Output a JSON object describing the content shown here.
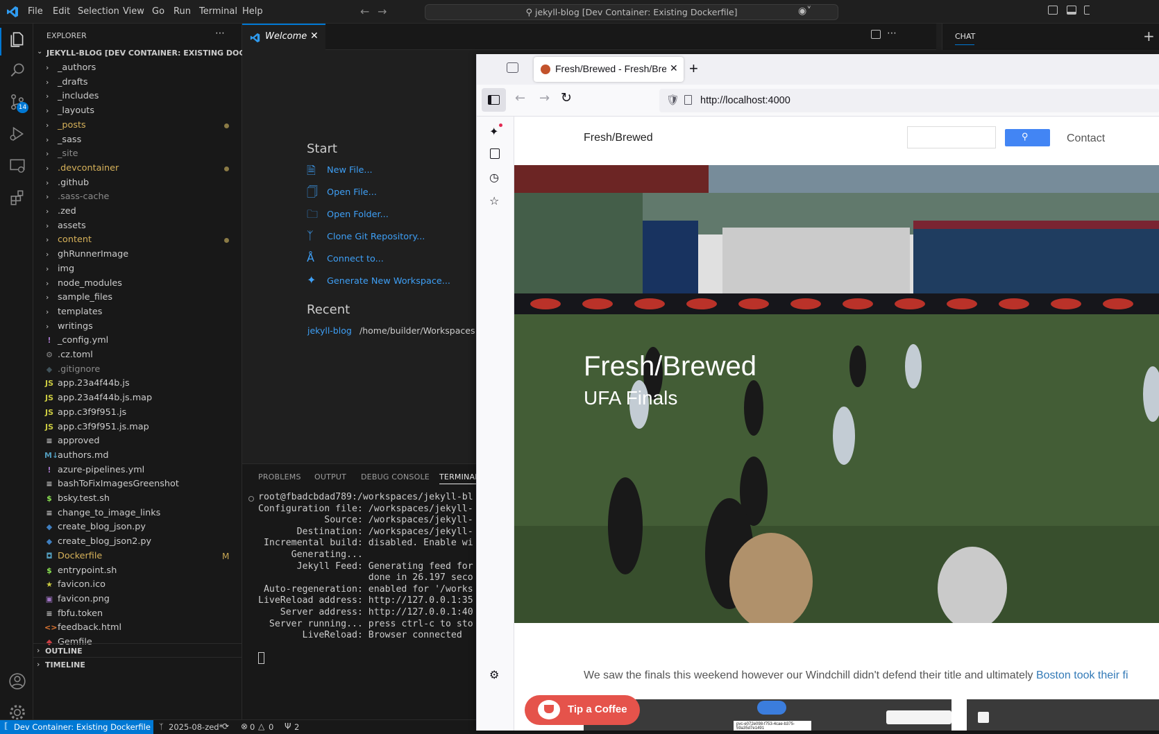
{
  "menu": [
    "File",
    "Edit",
    "Selection",
    "View",
    "Go",
    "Run",
    "Terminal",
    "Help"
  ],
  "command_center": "jekyll-blog [Dev Container: Existing Dockerfile]",
  "activity": {
    "scm_badge": "14"
  },
  "explorer": {
    "title": "EXPLORER",
    "root": "JEKYLL-BLOG [DEV CONTAINER: EXISTING DOCKER...",
    "items": [
      {
        "label": "_authors",
        "type": "folder"
      },
      {
        "label": "_drafts",
        "type": "folder"
      },
      {
        "label": "_includes",
        "type": "folder"
      },
      {
        "label": "_layouts",
        "type": "folder"
      },
      {
        "label": "_posts",
        "type": "folder",
        "modified": true
      },
      {
        "label": "_sass",
        "type": "folder"
      },
      {
        "label": "_site",
        "type": "folder",
        "dim": true
      },
      {
        "label": ".devcontainer",
        "type": "folder",
        "modified": true
      },
      {
        "label": ".github",
        "type": "folder"
      },
      {
        "label": ".sass-cache",
        "type": "folder",
        "dim": true
      },
      {
        "label": ".zed",
        "type": "folder"
      },
      {
        "label": "assets",
        "type": "folder"
      },
      {
        "label": "content",
        "type": "folder",
        "modified": true
      },
      {
        "label": "ghRunnerImage",
        "type": "folder"
      },
      {
        "label": "img",
        "type": "folder"
      },
      {
        "label": "node_modules",
        "type": "folder"
      },
      {
        "label": "sample_files",
        "type": "folder"
      },
      {
        "label": "templates",
        "type": "folder"
      },
      {
        "label": "writings",
        "type": "folder"
      },
      {
        "label": "_config.yml",
        "type": "yml"
      },
      {
        "label": ".cz.toml",
        "type": "gear"
      },
      {
        "label": ".gitignore",
        "type": "git",
        "dim": true
      },
      {
        "label": "app.23a4f44b.js",
        "type": "js"
      },
      {
        "label": "app.23a4f44b.js.map",
        "type": "js"
      },
      {
        "label": "app.c3f9f951.js",
        "type": "js"
      },
      {
        "label": "app.c3f9f951.js.map",
        "type": "js"
      },
      {
        "label": "approved",
        "type": "text"
      },
      {
        "label": "authors.md",
        "type": "md"
      },
      {
        "label": "azure-pipelines.yml",
        "type": "yml"
      },
      {
        "label": "bashToFixImagesGreenshot",
        "type": "text"
      },
      {
        "label": "bsky.test.sh",
        "type": "sh"
      },
      {
        "label": "change_to_image_links",
        "type": "text"
      },
      {
        "label": "create_blog_json.py",
        "type": "py"
      },
      {
        "label": "create_blog_json2.py",
        "type": "py"
      },
      {
        "label": "Dockerfile",
        "type": "docker",
        "flag": "M"
      },
      {
        "label": "entrypoint.sh",
        "type": "sh"
      },
      {
        "label": "favicon.ico",
        "type": "star"
      },
      {
        "label": "favicon.png",
        "type": "img"
      },
      {
        "label": "fbfu.token",
        "type": "text"
      },
      {
        "label": "feedback.html",
        "type": "html"
      },
      {
        "label": "Gemfile",
        "type": "gem"
      }
    ],
    "outline": "OUTLINE",
    "timeline": "TIMELINE"
  },
  "editor": {
    "tab_label": "Welcome",
    "start_title": "Start",
    "start_links": [
      "New File...",
      "Open File...",
      "Open Folder...",
      "Clone Git Repository...",
      "Connect to...",
      "Generate New Workspace..."
    ],
    "recent_title": "Recent",
    "recent_name": "jekyll-blog",
    "recent_path": "/home/builder/Workspaces"
  },
  "panel": {
    "tabs": [
      "PROBLEMS",
      "OUTPUT",
      "DEBUG CONSOLE",
      "TERMINAL"
    ],
    "terminal_lines": [
      "root@fbadcbdad789:/workspaces/jekyll-bl",
      "Configuration file: /workspaces/jekyll-",
      "            Source: /workspaces/jekyll-",
      "       Destination: /workspaces/jekyll-",
      " Incremental build: disabled. Enable wi",
      "      Generating...",
      "       Jekyll Feed: Generating feed for",
      "                    done in 26.197 seco",
      " Auto-regeneration: enabled for '/works",
      "LiveReload address: http://127.0.0.1:35",
      "    Server address: http://127.0.0.1:40",
      "  Server running... press ctrl-c to sto",
      "        LiveReload: Browser connected"
    ]
  },
  "chat": {
    "title": "CHAT"
  },
  "statusbar": {
    "remote": "Dev Container: Existing Dockerfile",
    "branch": "2025-08-zed*",
    "errors": "0",
    "warnings": "0",
    "ports": "2"
  },
  "browser": {
    "tab_title": "Fresh/Brewed - Fresh/Bre",
    "url": "http://localhost:4000",
    "site_name": "Fresh/Brewed",
    "nav_contact": "Contact",
    "hero_title": "Fresh/Brewed",
    "hero_subtitle": "UFA Finals",
    "body_text": "We saw the finals this weekend however our Windchill didn't defend their title and ultimately ",
    "body_link": "Boston took their fi",
    "tip_button": "Tip a Coffee",
    "screenshot_caption": "pvc-e072e098-f753-4cae-b375-59a35d7e1491"
  },
  "colors": {
    "accent": "#0078d4",
    "link": "#3e9ff5",
    "status_remote": "#0078d4",
    "search_button": "#4285f4",
    "tip_button": "#e5534b"
  }
}
